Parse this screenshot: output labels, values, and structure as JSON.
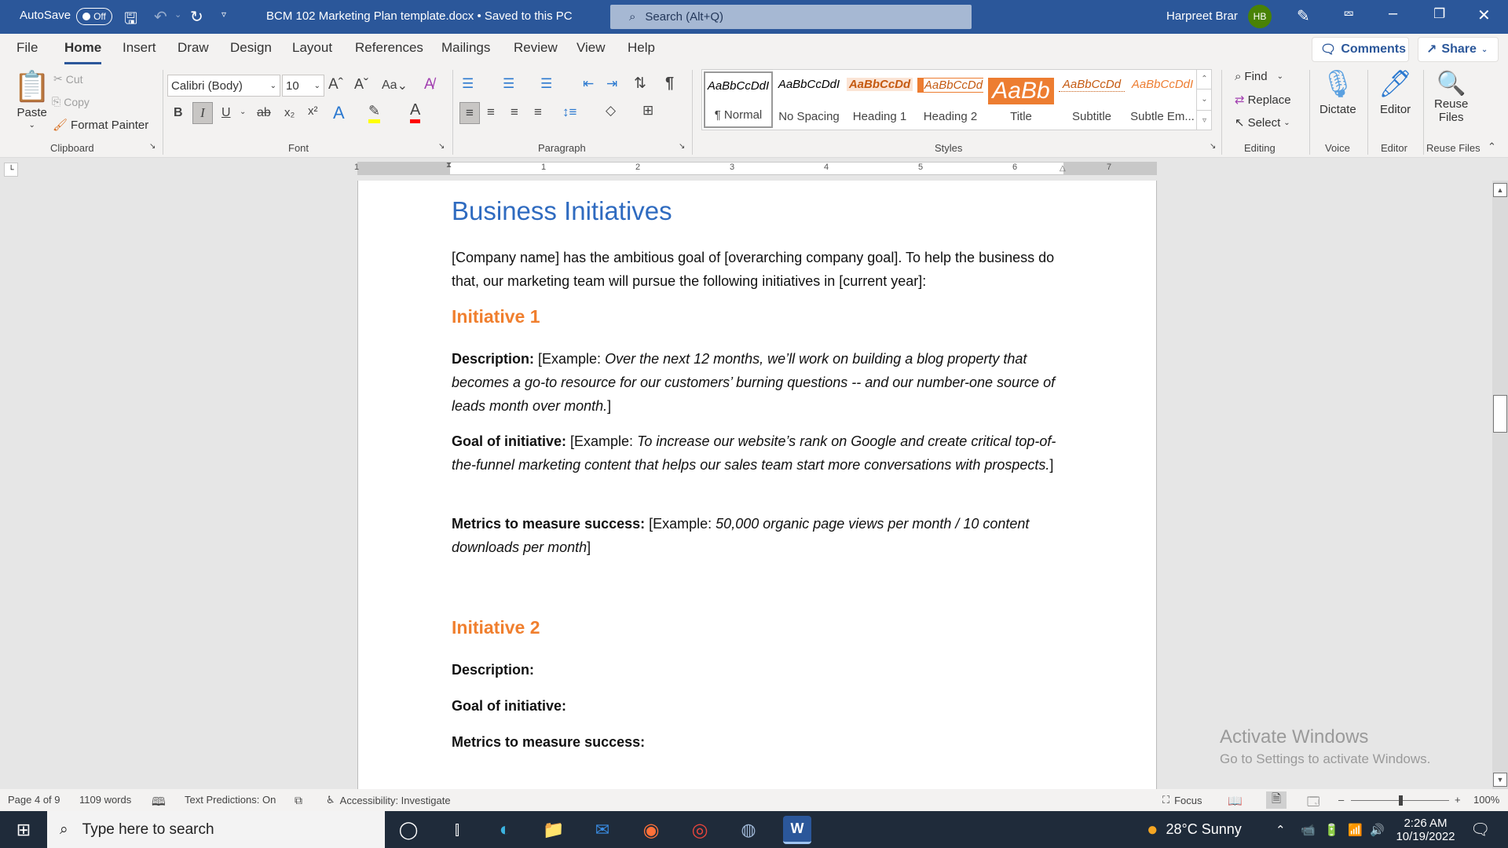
{
  "titlebar": {
    "autosave_label": "AutoSave",
    "autosave_state": "Off",
    "doc_title": "BCM 102 Marketing Plan template.docx • Saved to this PC",
    "search_placeholder": "Search (Alt+Q)",
    "user_name": "Harpreet Brar",
    "user_initials": "HB"
  },
  "menu": {
    "tabs": [
      "File",
      "Home",
      "Insert",
      "Draw",
      "Design",
      "Layout",
      "References",
      "Mailings",
      "Review",
      "View",
      "Help"
    ],
    "active_tab": "Home",
    "comments_label": "Comments",
    "share_label": "Share"
  },
  "ribbon": {
    "clipboard": {
      "paste": "Paste",
      "cut": "Cut",
      "copy": "Copy",
      "format_painter": "Format Painter",
      "label": "Clipboard"
    },
    "font": {
      "font_name": "Calibri (Body)",
      "font_size": "10",
      "change_case": "Aa",
      "label": "Font",
      "bold": "B",
      "italic": "I",
      "underline": "U",
      "strike": "ab",
      "subscript": "x₂",
      "superscript": "x²"
    },
    "paragraph": {
      "label": "Paragraph"
    },
    "styles": {
      "label": "Styles",
      "items": [
        {
          "preview": "AaBbCcDdI",
          "name": "¶ Normal"
        },
        {
          "preview": "AaBbCcDdI",
          "name": "No Spacing"
        },
        {
          "preview": "AaBbCcDd",
          "name": "Heading 1"
        },
        {
          "preview": "AaBbCcDd",
          "name": "Heading 2"
        },
        {
          "preview": "AaBb",
          "name": "Title"
        },
        {
          "preview": "AaBbCcDd",
          "name": "Subtitle"
        },
        {
          "preview": "AaBbCcDdI",
          "name": "Subtle Em..."
        }
      ]
    },
    "editing": {
      "find": "Find",
      "replace": "Replace",
      "select": "Select",
      "label": "Editing"
    },
    "voice": {
      "dictate": "Dictate",
      "label": "Voice"
    },
    "editor": {
      "editor": "Editor",
      "label": "Editor"
    },
    "reuse": {
      "line1": "Reuse",
      "line2": "Files",
      "label": "Reuse Files"
    }
  },
  "ruler": {
    "numbers": [
      "1",
      "1",
      "2",
      "3",
      "4",
      "5",
      "6",
      "7"
    ]
  },
  "document": {
    "title": "Business Initiatives",
    "intro": "[Company name] has the ambitious goal of [overarching company goal]. To help the business do that, our marketing team will pursue the following initiatives in [current year]:",
    "initiative1": {
      "heading": "Initiative 1",
      "desc_label": "Description:",
      "desc_prefix": " [Example: ",
      "desc_italic": "Over the next 12 months, we’ll work on building a blog property that becomes a go-to resource for our customers’ burning questions -- and our number-one source of leads month over month.",
      "desc_suffix": "]",
      "goal_label": "Goal of initiative:",
      "goal_prefix": " [Example: ",
      "goal_italic": "To increase our website’s rank on Google and create critical top-of-the-funnel marketing content that helps our sales team start more conversations with prospects.",
      "goal_suffix": "]",
      "metrics_label": "Metrics to measure success:",
      "metrics_prefix": " [Example: ",
      "metrics_italic": "50,000 organic page views per month / 10 content downloads per month",
      "metrics_suffix": "]"
    },
    "initiative2": {
      "heading": "Initiative 2",
      "desc_label": "Description:",
      "goal_label": "Goal of initiative:",
      "metrics_label": "Metrics to measure success:"
    }
  },
  "watermark": {
    "line1": "Activate Windows",
    "line2": "Go to Settings to activate Windows."
  },
  "statusbar": {
    "page": "Page 4 of 9",
    "words": "1109 words",
    "text_predictions": "Text Predictions: On",
    "accessibility": "Accessibility: Investigate",
    "focus": "Focus",
    "zoom": "100%",
    "zoom_fraction": 0.5
  },
  "taskbar": {
    "search_placeholder": "Type here to search",
    "weather": "28°C  Sunny",
    "time": "2:26 AM",
    "date": "10/19/2022"
  }
}
